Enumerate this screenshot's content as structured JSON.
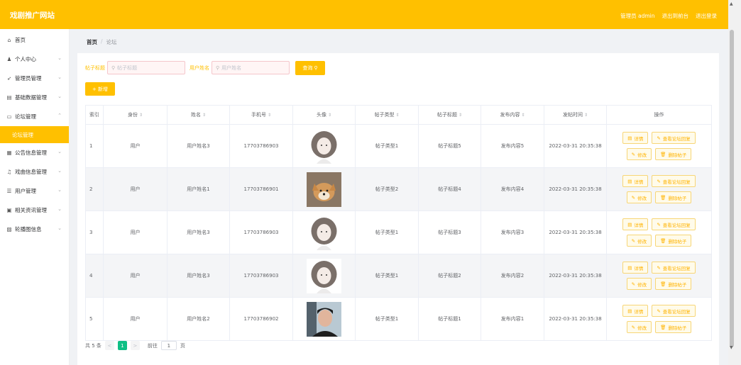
{
  "header": {
    "logo": "戏剧推广网站",
    "admin_label": "管理员 admin",
    "back_label": "退出到前台",
    "logout_label": "退出登录"
  },
  "sidebar": {
    "items": [
      {
        "label": "首页",
        "icon": "home-icon",
        "has_chevron": false
      },
      {
        "label": "个人中心",
        "icon": "user-icon",
        "has_chevron": true
      },
      {
        "label": "管理员管理",
        "icon": "send-icon",
        "has_chevron": true
      },
      {
        "label": "基础数据管理",
        "icon": "delete-icon",
        "has_chevron": true
      },
      {
        "label": "论坛管理",
        "icon": "chat-icon",
        "has_chevron": true
      }
    ],
    "active_submenu": "论坛管理",
    "items_after": [
      {
        "label": "公告信息管理",
        "icon": "grid-icon"
      },
      {
        "label": "戏曲信息管理",
        "icon": "bell-icon"
      },
      {
        "label": "用户管理",
        "icon": "menu-icon"
      },
      {
        "label": "相关资讯管理",
        "icon": "news-icon"
      },
      {
        "label": "轮播图信息",
        "icon": "image-icon"
      }
    ]
  },
  "breadcrumb": {
    "home": "首页",
    "separator": "/",
    "current": "论坛"
  },
  "search": {
    "title_label": "帖子标题",
    "title_placeholder": "帖子标题",
    "user_label": "用户姓名",
    "user_placeholder": "用户姓名",
    "button": "查询"
  },
  "add_button": "+ 新增",
  "table": {
    "headers": [
      "索引",
      "身份",
      "姓名",
      "手机号",
      "头像",
      "帖子类型",
      "帖子标题",
      "发布内容",
      "发帖时间",
      "操作"
    ],
    "rows": [
      {
        "index": "1",
        "role": "用户",
        "name": "用户姓名3",
        "phone": "17703786903",
        "avatar": "girl",
        "type": "帖子类型1",
        "title": "帖子标题5",
        "content": "发布内容5",
        "time": "2022-03-31 20:35:38"
      },
      {
        "index": "2",
        "role": "用户",
        "name": "用户姓名1",
        "phone": "17703786901",
        "avatar": "dog",
        "type": "帖子类型2",
        "title": "帖子标题4",
        "content": "发布内容4",
        "time": "2022-03-31 20:35:38"
      },
      {
        "index": "3",
        "role": "用户",
        "name": "用户姓名3",
        "phone": "17703786903",
        "avatar": "girl",
        "type": "帖子类型1",
        "title": "帖子标题3",
        "content": "发布内容3",
        "time": "2022-03-31 20:35:38"
      },
      {
        "index": "4",
        "role": "用户",
        "name": "用户姓名3",
        "phone": "17703786903",
        "avatar": "girl",
        "type": "帖子类型1",
        "title": "帖子标题2",
        "content": "发布内容2",
        "time": "2022-03-31 20:35:38"
      },
      {
        "index": "5",
        "role": "用户",
        "name": "用户姓名2",
        "phone": "17703786902",
        "avatar": "man",
        "type": "帖子类型1",
        "title": "帖子标题1",
        "content": "发布内容1",
        "time": "2022-03-31 20:35:38"
      }
    ],
    "ops": {
      "detail": "详情",
      "view_reply": "查看论坛回复",
      "edit": "修改",
      "delete": "删除帖子"
    }
  },
  "pager": {
    "total": "共 5 条",
    "prev": "<",
    "current": "1",
    "next": ">",
    "goto": "前往",
    "page_value": "1",
    "page_unit": "页"
  },
  "colors": {
    "accent": "#ffc000",
    "pager_active": "#0fbf85"
  }
}
